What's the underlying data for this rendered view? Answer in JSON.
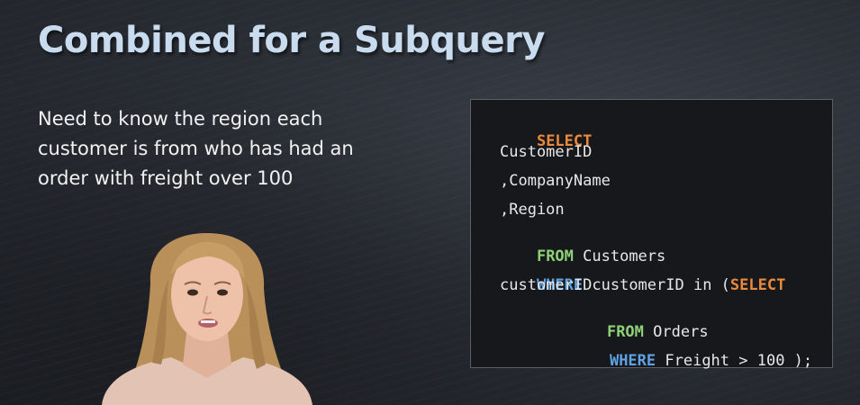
{
  "slide": {
    "title": "Combined for a Subquery",
    "body": "Need to know the region each customer is from who has had an order with freight over 100"
  },
  "code": {
    "line1_kw": "SELECT",
    "line2": "CustomerID",
    "line3": ",CompanyName",
    "line4": ",Region",
    "line5_kw": "FROM",
    "line5_rest": " Customers",
    "line6_kw": "WHERE",
    "line6_mid": " customerID in (",
    "line6_kw2": "SELECT",
    "line7": "customerID",
    "line8_kw": "FROM",
    "line8_rest": " Orders",
    "line9_kw": "WHERE",
    "line9_rest": " Freight > 100 );"
  },
  "colors": {
    "title": "#c9dcef",
    "keyword_select": "#ec8a3c",
    "keyword_from": "#8fd178",
    "keyword_where": "#5fa3e6",
    "code_background": "#17181b"
  }
}
